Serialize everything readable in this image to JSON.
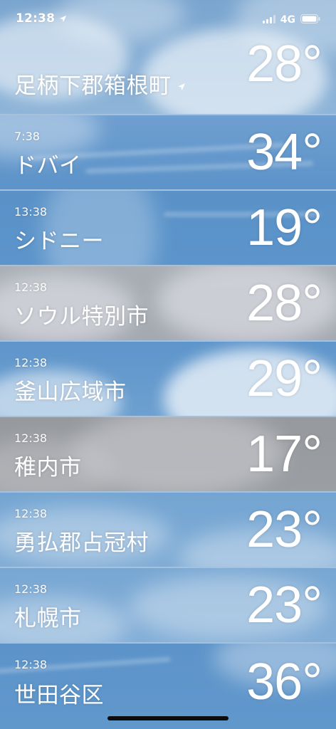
{
  "status_bar": {
    "time": "12:38",
    "location_icon": "location-arrow-icon",
    "signal_icon": "cellular-signal-icon",
    "network": "4G",
    "battery_icon": "battery-icon"
  },
  "cities": [
    {
      "local_time": "",
      "name": "足柄下郡箱根町",
      "temperature": "28°",
      "current_location": true,
      "sky": "light-clouds"
    },
    {
      "local_time": "7:38",
      "name": "ドバイ",
      "temperature": "34°",
      "current_location": false,
      "sky": "clear"
    },
    {
      "local_time": "13:38",
      "name": "シドニー",
      "temperature": "19°",
      "current_location": false,
      "sky": "clear-sun"
    },
    {
      "local_time": "12:38",
      "name": "ソウル特別市",
      "temperature": "28°",
      "current_location": false,
      "sky": "overcast"
    },
    {
      "local_time": "12:38",
      "name": "釜山広域市",
      "temperature": "29°",
      "current_location": false,
      "sky": "cumulus"
    },
    {
      "local_time": "12:38",
      "name": "稚内市",
      "temperature": "17°",
      "current_location": false,
      "sky": "grey-overcast"
    },
    {
      "local_time": "12:38",
      "name": "勇払郡占冠村",
      "temperature": "23°",
      "current_location": false,
      "sky": "light-clouds"
    },
    {
      "local_time": "12:38",
      "name": "札幌市",
      "temperature": "23°",
      "current_location": false,
      "sky": "light-clouds"
    },
    {
      "local_time": "12:38",
      "name": "世田谷区",
      "temperature": "36°",
      "current_location": false,
      "sky": "clear"
    }
  ],
  "colors": {
    "sky_blue": "#5b93c8",
    "overcast_grey": "#9a9ea4",
    "text": "#ffffff"
  }
}
